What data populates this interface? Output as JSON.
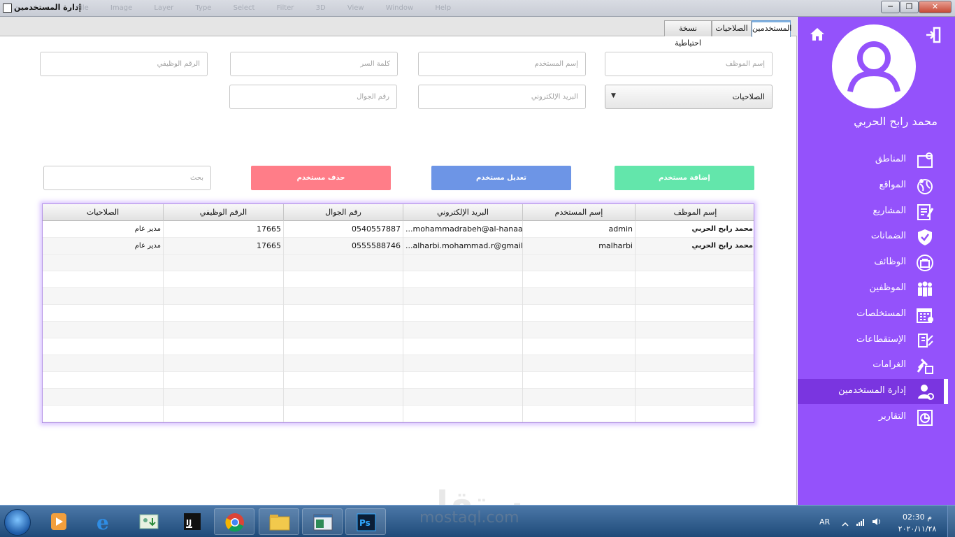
{
  "window": {
    "title": "إدارة المستخدمين",
    "ghost_menu": "File Image Layer Type Select Filter 3D View Window Help",
    "minimize": "─",
    "maximize": "❐",
    "close": "✕"
  },
  "tabs": [
    "المستخدمين",
    "الصلاحيات",
    "نسخة احتياطية"
  ],
  "form": {
    "employee_name_placeholder": "إسم الموظف",
    "username_placeholder": "إسم المستخدم",
    "password_placeholder": "كلمة السر",
    "job_number_placeholder": "الرقم الوظيفي",
    "permissions_select": "الصلاحيات",
    "email_placeholder": "البريد الإلكتروني",
    "mobile_placeholder": "رقم الجوال",
    "search_placeholder": "بحث"
  },
  "buttons": {
    "add": "إضافة مستخدم",
    "edit": "تعديل مستخدم",
    "delete": "حذف مستخدم"
  },
  "table": {
    "headers": {
      "employee": "إسم الموظف",
      "username": "إسم المستخدم",
      "email": "البريد الإلكتروني",
      "mobile": "رقم الجوال",
      "job_number": "الرقم الوظيفي",
      "permissions": "الصلاحيات"
    },
    "rows": [
      {
        "employee": "محمد رابح الحربي",
        "username": "admin",
        "email": "...mohammadrabeh@al-hanaa",
        "mobile": "0540557887",
        "job_number": "17665",
        "permissions": "مدير عام"
      },
      {
        "employee": "محمد رابح الحربي",
        "username": "malharbi",
        "email": "...alharbi.mohammad.r@gmail",
        "mobile": "0555588746",
        "job_number": "17665",
        "permissions": "مدير عام"
      }
    ]
  },
  "sidebar": {
    "user_name": "محمد رابح الحربي",
    "items": [
      {
        "label": "المناطق",
        "icon": "map-icon"
      },
      {
        "label": "المواقع",
        "icon": "globe-icon"
      },
      {
        "label": "المشاريع",
        "icon": "projects-icon"
      },
      {
        "label": "الضمانات",
        "icon": "shield-icon"
      },
      {
        "label": "الوظائف",
        "icon": "briefcase-icon"
      },
      {
        "label": "الموظفين",
        "icon": "employees-icon"
      },
      {
        "label": "المستخلصات",
        "icon": "calendar-icon"
      },
      {
        "label": "الإستقطاعات",
        "icon": "deductions-icon"
      },
      {
        "label": "الغرامات",
        "icon": "gavel-icon"
      },
      {
        "label": "إدارة المستخدمين",
        "icon": "user-settings-icon"
      },
      {
        "label": "التقارير",
        "icon": "reports-icon"
      }
    ],
    "active_item": "إدارة المستخدمين"
  },
  "taskbar": {
    "language": "AR",
    "time": "02:30 م",
    "date": "٢٠٢٠/١١/٢٨"
  },
  "watermark": {
    "arabic": "مستقل",
    "latin": "mostaql.com"
  },
  "colors": {
    "sidebar": "#9452fb",
    "sidebar_active": "#7a35e0",
    "add_button": "#63e6ab",
    "edit_button": "#6d95e6",
    "delete_button": "#ff7d88",
    "table_glow": "#b082ff"
  }
}
